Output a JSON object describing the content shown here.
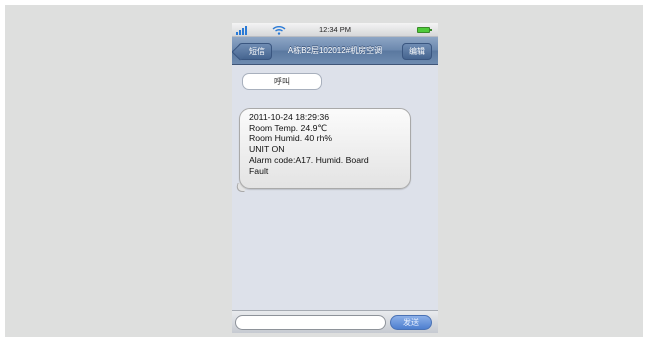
{
  "status_bar": {
    "time": "12:34 PM"
  },
  "nav": {
    "back_label": "短信",
    "title": "A栋B2层102012#机房空调",
    "edit_label": "编辑"
  },
  "call_label": "呼叫",
  "message": {
    "lines": [
      "2011-10-24 18:29:36",
      "Room Temp. 24.9℃",
      "Room Humid. 40 rh%",
      "UNIT ON",
      "Alarm code:A17. Humid. Board",
      "Fault"
    ]
  },
  "compose": {
    "input_value": "",
    "send_label": "发送"
  },
  "colors": {
    "nav_bar": "#6a87ad",
    "screen_bg": "#dde1ea",
    "send_button": "#4e7fcf"
  },
  "icons": [
    "signal-icon",
    "wifi-icon",
    "battery-icon",
    "back-arrow-icon"
  ]
}
